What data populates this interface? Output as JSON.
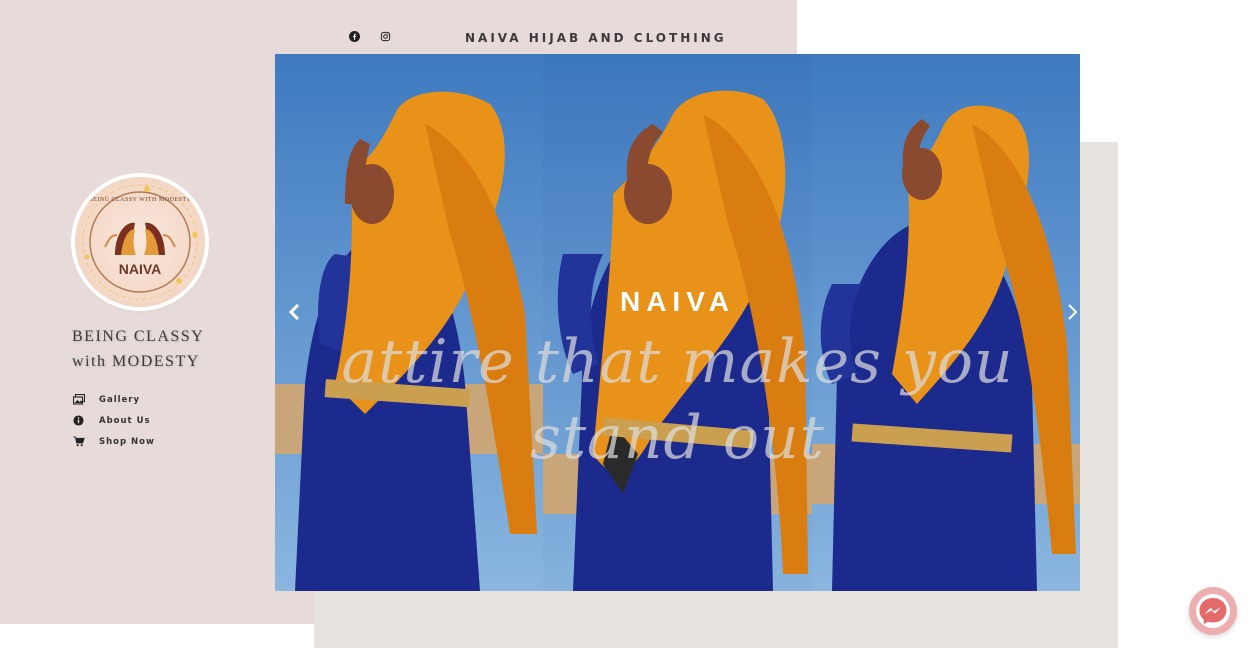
{
  "header": {
    "site_title": "NAIVA HIJAB AND CLOTHING",
    "social": [
      {
        "icon": "facebook-icon"
      },
      {
        "icon": "instagram-icon"
      }
    ]
  },
  "sidebar": {
    "logo": {
      "name": "NAIVA",
      "arc_text": "BEING CLASSY WITH MODESTY"
    },
    "tagline_line1": "BEING CLASSY",
    "tagline_line2": "with MODESTY",
    "nav": [
      {
        "label": "Gallery",
        "icon": "gallery-icon"
      },
      {
        "label": "About Us",
        "icon": "info-icon"
      },
      {
        "label": "Shop Now",
        "icon": "cart-icon"
      }
    ]
  },
  "slider": {
    "brand": "NAIVA",
    "tagline": "attire that makes you stand out"
  },
  "colors": {
    "left_panel": "#e6dbd8",
    "right_panel": "#e6e2dd",
    "headscarf": "#e8921a",
    "dress": "#1b2a8c",
    "sky": "#4a86c8",
    "messenger_bg": "#ecaeae"
  }
}
